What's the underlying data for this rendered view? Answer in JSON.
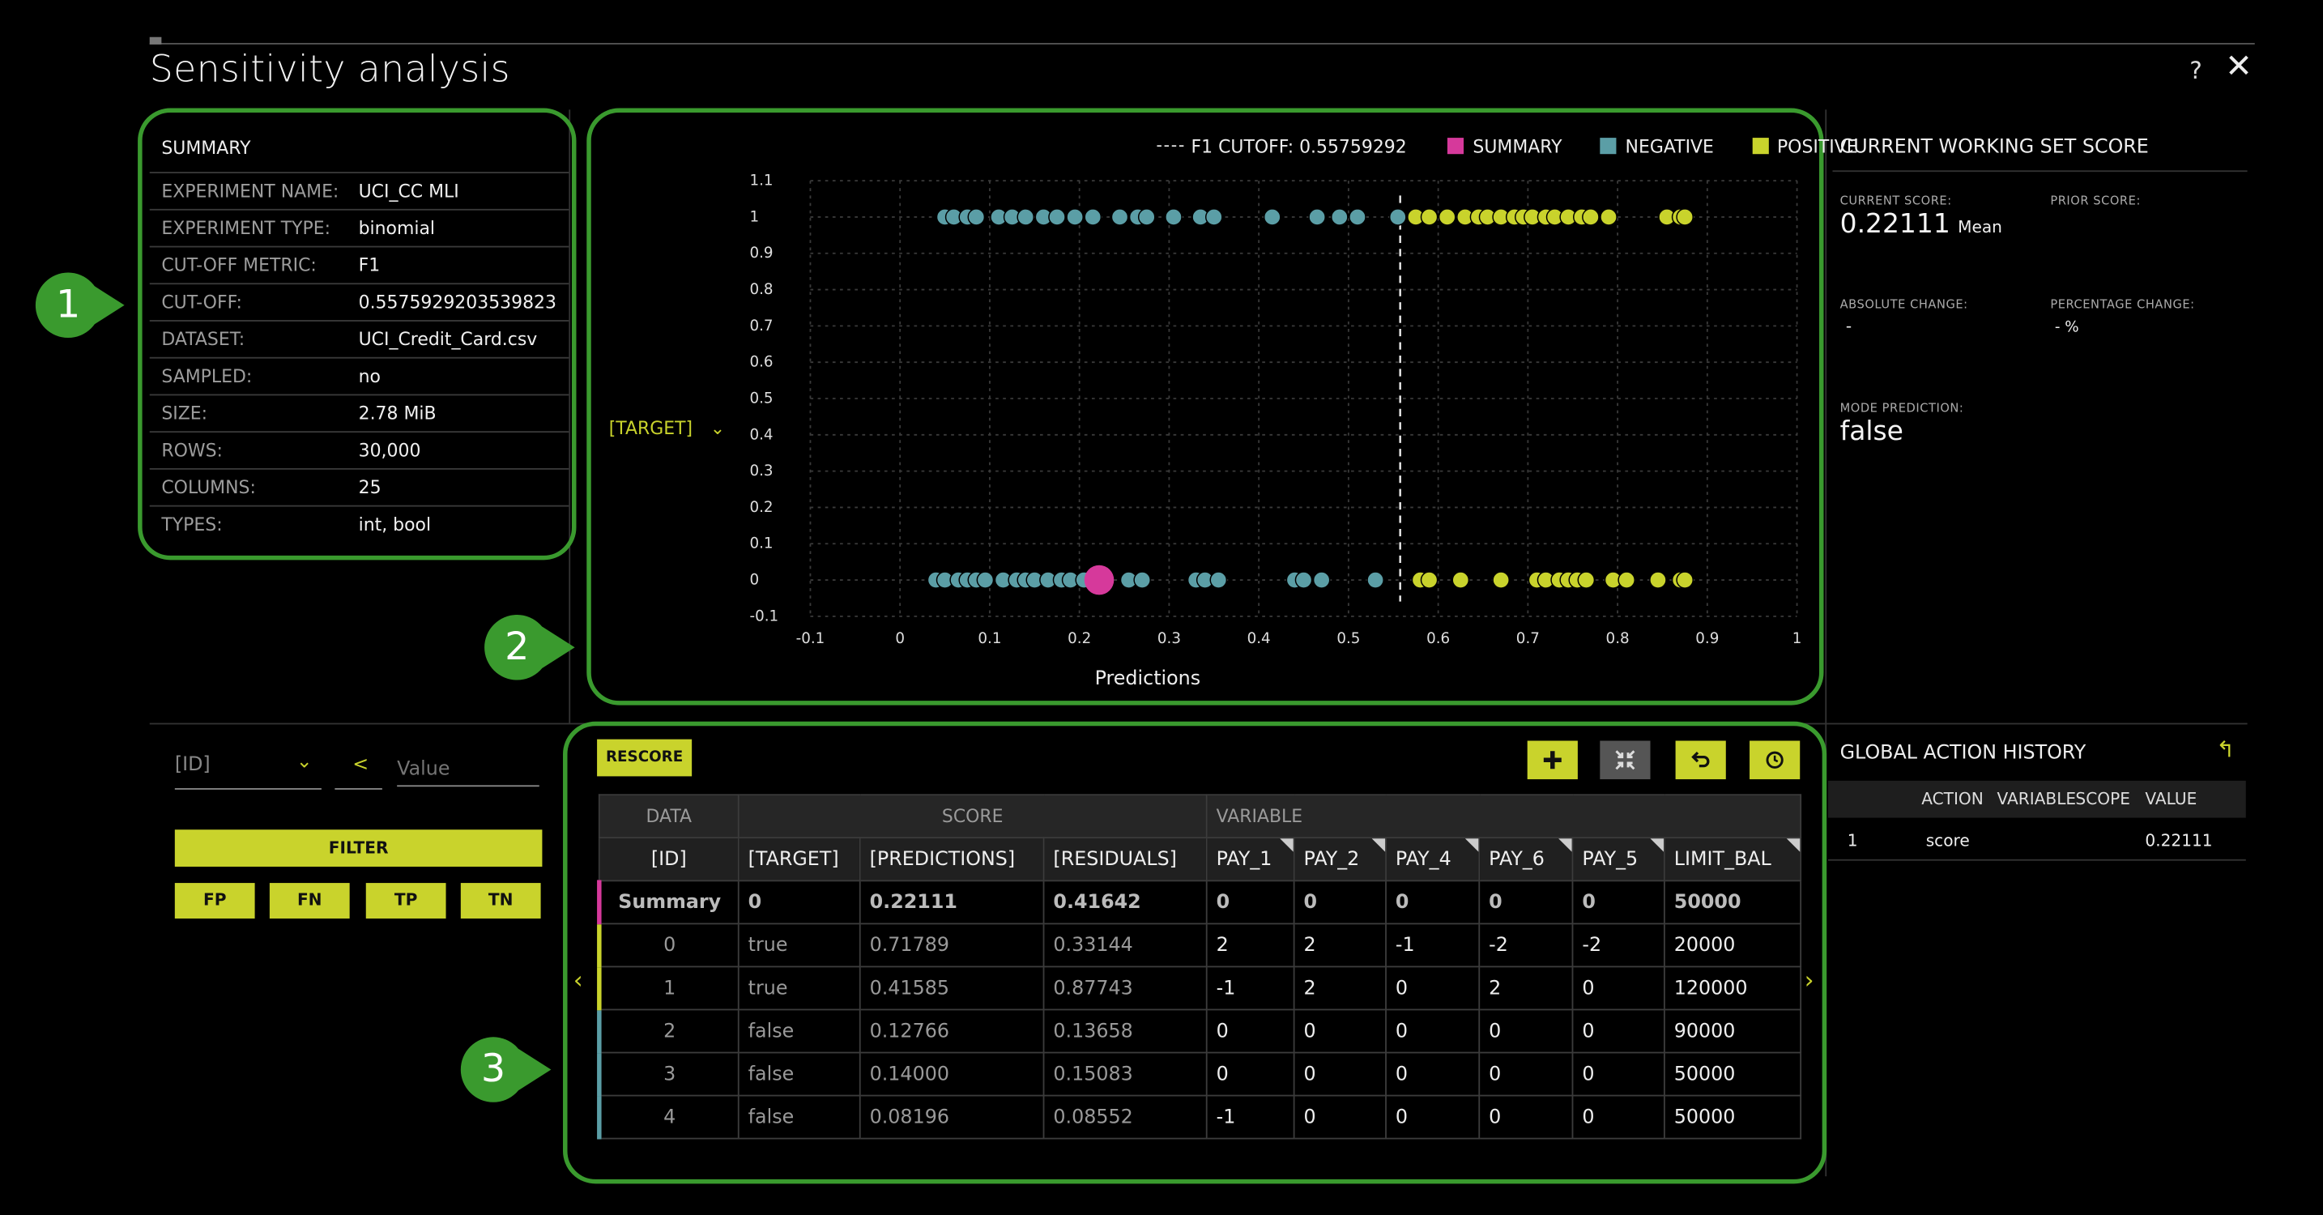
{
  "window": {
    "title": "Sensitivity analysis",
    "help_label": "?",
    "close_label": "✕"
  },
  "callouts": [
    "1",
    "2",
    "3"
  ],
  "summary": {
    "title": "SUMMARY",
    "rows": [
      {
        "key": "EXPERIMENT NAME:",
        "value": "UCI_CC MLI"
      },
      {
        "key": "EXPERIMENT TYPE:",
        "value": "binomial"
      },
      {
        "key": "CUT-OFF METRIC:",
        "value": "F1"
      },
      {
        "key": "CUT-OFF:",
        "value": "0.5575929203539823"
      },
      {
        "key": "DATASET:",
        "value": "UCI_Credit_Card.csv"
      },
      {
        "key": "SAMPLED:",
        "value": "no"
      },
      {
        "key": "SIZE:",
        "value": "2.78 MiB"
      },
      {
        "key": "ROWS:",
        "value": "30,000"
      },
      {
        "key": "COLUMNS:",
        "value": "25"
      },
      {
        "key": "TYPES:",
        "value": "int, bool"
      }
    ]
  },
  "chart_data": {
    "type": "scatter",
    "xlabel": "Predictions",
    "ylabel_select": "[TARGET]",
    "xlim": [
      -0.1,
      1
    ],
    "ylim": [
      -0.1,
      1.1
    ],
    "x_ticks": [
      "-0.1",
      "0",
      "0.1",
      "0.2",
      "0.3",
      "0.4",
      "0.5",
      "0.6",
      "0.7",
      "0.8",
      "0.9",
      "1"
    ],
    "y_ticks": [
      "1.1",
      "1",
      "0.9",
      "0.8",
      "0.7",
      "0.6",
      "0.5",
      "0.4",
      "0.3",
      "0.2",
      "0.1",
      "0",
      "-0.1"
    ],
    "grid": true,
    "legend_position": "top-right",
    "cutoff": {
      "label": "F1 CUTOFF: 0.55759292",
      "x": 0.5576
    },
    "series": [
      {
        "name": "SUMMARY",
        "color": "#d6399b",
        "points": [
          [
            0.222,
            0
          ]
        ]
      },
      {
        "name": "NEGATIVE",
        "color": "#5b9ea6",
        "points": [
          [
            0.05,
            1
          ],
          [
            0.06,
            1
          ],
          [
            0.075,
            1
          ],
          [
            0.085,
            1
          ],
          [
            0.11,
            1
          ],
          [
            0.125,
            1
          ],
          [
            0.14,
            1
          ],
          [
            0.16,
            1
          ],
          [
            0.175,
            1
          ],
          [
            0.195,
            1
          ],
          [
            0.215,
            1
          ],
          [
            0.245,
            1
          ],
          [
            0.265,
            1
          ],
          [
            0.275,
            1
          ],
          [
            0.305,
            1
          ],
          [
            0.335,
            1
          ],
          [
            0.35,
            1
          ],
          [
            0.415,
            1
          ],
          [
            0.465,
            1
          ],
          [
            0.49,
            1
          ],
          [
            0.51,
            1
          ],
          [
            0.555,
            1
          ],
          [
            0.04,
            0
          ],
          [
            0.05,
            0
          ],
          [
            0.065,
            0
          ],
          [
            0.075,
            0
          ],
          [
            0.085,
            0
          ],
          [
            0.095,
            0
          ],
          [
            0.115,
            0
          ],
          [
            0.13,
            0
          ],
          [
            0.14,
            0
          ],
          [
            0.15,
            0
          ],
          [
            0.165,
            0
          ],
          [
            0.18,
            0
          ],
          [
            0.19,
            0
          ],
          [
            0.205,
            0
          ],
          [
            0.255,
            0
          ],
          [
            0.27,
            0
          ],
          [
            0.33,
            0
          ],
          [
            0.34,
            0
          ],
          [
            0.355,
            0
          ],
          [
            0.44,
            0
          ],
          [
            0.45,
            0
          ],
          [
            0.47,
            0
          ],
          [
            0.53,
            0
          ]
        ]
      },
      {
        "name": "POSITIVE",
        "color": "#c9d32c",
        "points": [
          [
            0.575,
            1
          ],
          [
            0.59,
            1
          ],
          [
            0.61,
            1
          ],
          [
            0.63,
            1
          ],
          [
            0.645,
            1
          ],
          [
            0.655,
            1
          ],
          [
            0.67,
            1
          ],
          [
            0.685,
            1
          ],
          [
            0.695,
            1
          ],
          [
            0.705,
            1
          ],
          [
            0.72,
            1
          ],
          [
            0.73,
            1
          ],
          [
            0.745,
            1
          ],
          [
            0.76,
            1
          ],
          [
            0.77,
            1
          ],
          [
            0.79,
            1
          ],
          [
            0.855,
            1
          ],
          [
            0.87,
            1
          ],
          [
            0.875,
            1
          ],
          [
            0.58,
            0
          ],
          [
            0.59,
            0
          ],
          [
            0.625,
            0
          ],
          [
            0.67,
            0
          ],
          [
            0.71,
            0
          ],
          [
            0.72,
            0
          ],
          [
            0.735,
            0
          ],
          [
            0.745,
            0
          ],
          [
            0.755,
            0
          ],
          [
            0.765,
            0
          ],
          [
            0.795,
            0
          ],
          [
            0.81,
            0
          ],
          [
            0.845,
            0
          ],
          [
            0.87,
            0
          ],
          [
            0.875,
            0
          ]
        ]
      }
    ]
  },
  "working_set": {
    "title": "CURRENT WORKING SET SCORE",
    "current_score_label": "CURRENT SCORE:",
    "current_score_value": "0.22111",
    "current_score_unit": "Mean",
    "prior_score_label": "PRIOR SCORE:",
    "absolute_change_label": "ABSOLUTE CHANGE:",
    "absolute_change_value": "-",
    "percentage_change_label": "PERCENTAGE CHANGE:",
    "percentage_change_value": "- %",
    "mode_prediction_label": "MODE PREDICTION:",
    "mode_prediction_value": "false"
  },
  "filter": {
    "column_select": "[ID]",
    "operator": "<",
    "value_placeholder": "Value",
    "filter_button": "FILTER",
    "quick_buttons": [
      "FP",
      "FN",
      "TP",
      "TN"
    ]
  },
  "table": {
    "rescore_button": "RESCORE",
    "toolbar_icons": [
      "plus-icon",
      "compress-icon",
      "undo-icon",
      "reset-history-icon"
    ],
    "groups": [
      {
        "label": "DATA"
      },
      {
        "label": "SCORE"
      },
      {
        "label": "VARIABLE"
      }
    ],
    "columns": [
      "[ID]",
      "[TARGET]",
      "[PREDICTIONS]",
      "[RESIDUALS]",
      "PAY_1",
      "PAY_2",
      "PAY_4",
      "PAY_6",
      "PAY_5",
      "LIMIT_BAL"
    ],
    "summary_row": [
      "Summary",
      "0",
      "0.22111",
      "0.41642",
      "0",
      "0",
      "0",
      "0",
      "0",
      "50000"
    ],
    "rows": [
      [
        "0",
        "true",
        "0.71789",
        "0.33144",
        "2",
        "2",
        "-1",
        "-2",
        "-2",
        "20000"
      ],
      [
        "1",
        "true",
        "0.41585",
        "0.87743",
        "-1",
        "2",
        "0",
        "2",
        "0",
        "120000"
      ],
      [
        "2",
        "false",
        "0.12766",
        "0.13658",
        "0",
        "0",
        "0",
        "0",
        "0",
        "90000"
      ],
      [
        "3",
        "false",
        "0.14000",
        "0.15083",
        "0",
        "0",
        "0",
        "0",
        "0",
        "50000"
      ],
      [
        "4",
        "false",
        "0.08196",
        "0.08552",
        "-1",
        "0",
        "0",
        "0",
        "0",
        "50000"
      ]
    ],
    "row_marker_colors": [
      "#d6399b",
      "#c9d32c",
      "#c9d32c",
      "#5b9ea6",
      "#5b9ea6",
      "#5b9ea6"
    ],
    "prev_label": "‹",
    "next_label": "›"
  },
  "history": {
    "title": "GLOBAL ACTION HISTORY",
    "columns": [
      "ACTION",
      "VARIABLE",
      "SCOPE",
      "VALUE"
    ],
    "rows": [
      {
        "index": "1",
        "action": "score",
        "variable": "",
        "scope": "",
        "value": "0.22111"
      }
    ]
  }
}
